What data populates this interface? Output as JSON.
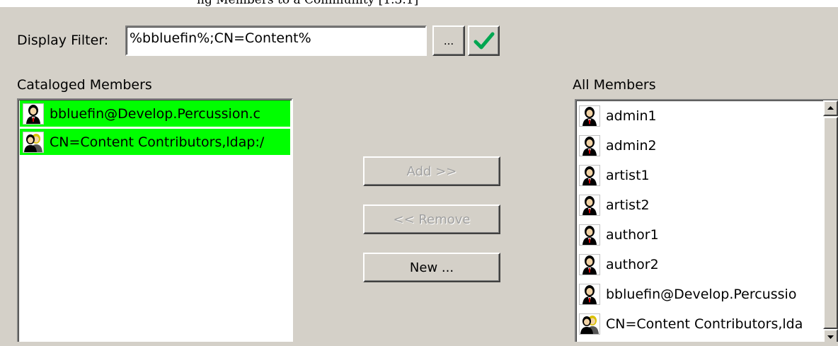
{
  "caption": "ng Members to a Community [1.3.1]",
  "filter": {
    "label": "Display Filter:",
    "value": "%bbluefin%;CN=Content%",
    "browse_label": "...",
    "apply_icon": "checkmark-icon"
  },
  "cataloged": {
    "label": "Cataloged Members",
    "items": [
      {
        "label": "bbluefin@Develop.Percussion.c",
        "icon": "user-icon",
        "selected": true
      },
      {
        "label": "CN=Content Contributors,ldap:/",
        "icon": "group-icon",
        "selected": true
      }
    ]
  },
  "actions": {
    "add_label": "Add >>",
    "remove_label": "<< Remove",
    "new_label": "New ..."
  },
  "all": {
    "label": "All Members",
    "items": [
      {
        "label": "admin1",
        "icon": "user-icon"
      },
      {
        "label": "admin2",
        "icon": "user-icon"
      },
      {
        "label": "artist1",
        "icon": "user-icon"
      },
      {
        "label": "artist2",
        "icon": "user-icon"
      },
      {
        "label": "author1",
        "icon": "user-icon"
      },
      {
        "label": "author2",
        "icon": "user-icon"
      },
      {
        "label": "bbluefin@Develop.Percussio",
        "icon": "user-icon"
      },
      {
        "label": "CN=Content Contributors,lda",
        "icon": "group-icon"
      }
    ]
  },
  "colors": {
    "selection": "#00ff00",
    "check": "#00a651"
  }
}
